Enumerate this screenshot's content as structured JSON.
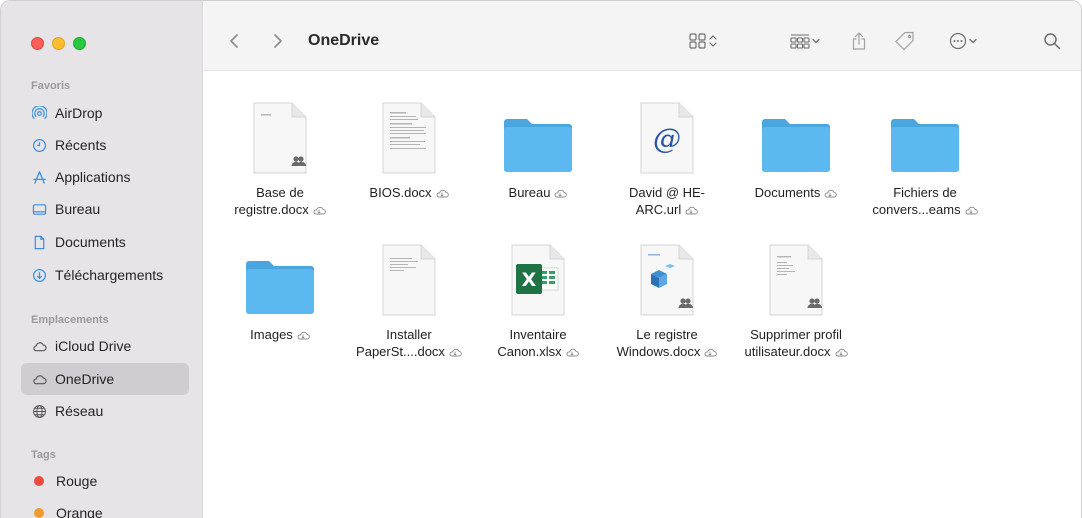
{
  "window": {
    "title": "OneDrive"
  },
  "sidebar": {
    "favorites_title": "Favoris",
    "favorites": [
      {
        "label": "AirDrop",
        "icon": "airdrop-icon"
      },
      {
        "label": "Récents",
        "icon": "clock-icon"
      },
      {
        "label": "Applications",
        "icon": "applications-icon"
      },
      {
        "label": "Bureau",
        "icon": "desktop-icon"
      },
      {
        "label": "Documents",
        "icon": "document-icon"
      },
      {
        "label": "Téléchargements",
        "icon": "download-icon"
      }
    ],
    "locations_title": "Emplacements",
    "locations": [
      {
        "label": "iCloud Drive",
        "icon": "cloud-icon"
      },
      {
        "label": "OneDrive",
        "icon": "cloud-icon",
        "selected": true
      },
      {
        "label": "Réseau",
        "icon": "network-icon"
      }
    ],
    "tags_title": "Tags",
    "tags": [
      {
        "label": "Rouge",
        "color": "#ee4b3e"
      },
      {
        "label": "Orange",
        "color": "#f29b2d"
      }
    ]
  },
  "files": [
    {
      "line1": "Base de",
      "line2": "registre.docx",
      "type": "doc-shared"
    },
    {
      "line1": "BIOS.docx",
      "line2": "",
      "type": "doc"
    },
    {
      "line1": "Bureau",
      "line2": "",
      "type": "folder"
    },
    {
      "line1": "David @ HE-",
      "line2": "ARC.url",
      "type": "url"
    },
    {
      "line1": "Documents",
      "line2": "",
      "type": "folder"
    },
    {
      "line1": "Fichiers de",
      "line2": "convers...eams",
      "type": "folder"
    },
    {
      "line1": "Images",
      "line2": "",
      "type": "folder"
    },
    {
      "line1": "Installer",
      "line2": "PaperSt....docx",
      "type": "doc"
    },
    {
      "line1": "Inventaire",
      "line2": "Canon.xlsx",
      "type": "xlsx"
    },
    {
      "line1": "Le registre",
      "line2": "Windows.docx",
      "type": "doc-shared-image"
    },
    {
      "line1": "Supprimer profil",
      "line2": "utilisateur.docx",
      "type": "doc-shared"
    }
  ],
  "colors": {
    "folder": "#5bb9ef",
    "folder_tab": "#4aa6de",
    "sidebar_selected": "#cfcdd1",
    "excel": "#1f7244"
  }
}
